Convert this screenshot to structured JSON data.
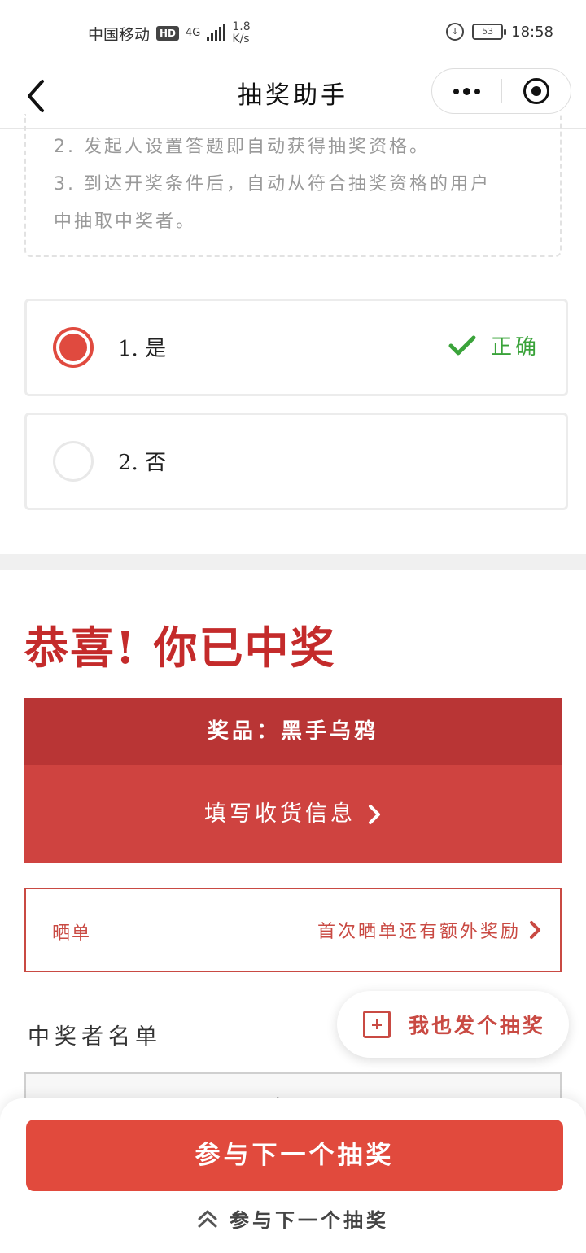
{
  "status_bar": {
    "carrier": "中国移动",
    "hd": "HD",
    "network": "4G",
    "speed_value": "1.8",
    "speed_unit": "K/s",
    "battery": "53",
    "time": "18:58"
  },
  "nav": {
    "title": "抽奖助手"
  },
  "rules": [
    "2. 发起人设置答题即自动获得抽奖资格。",
    "3. 到达开奖条件后，自动从符合抽奖资格的用户",
    "中抽取中奖者。"
  ],
  "options": [
    {
      "label": "1. 是",
      "selected": true,
      "result": "正确"
    },
    {
      "label": "2. 否",
      "selected": false,
      "result": ""
    }
  ],
  "congrats": "恭喜! 你已中奖",
  "prize": {
    "name": "奖品：黑手乌鸦",
    "fill_info": "填写收货信息"
  },
  "share": {
    "label": "晒单",
    "hint": "首次晒单还有额外奖励"
  },
  "winners": {
    "title": "中奖者名单",
    "partial_text": "点..."
  },
  "fab": {
    "label": "我也发个抽奖"
  },
  "bottom": {
    "next_button": "参与下一个抽奖",
    "sub_link": "参与下一个抽奖"
  },
  "colors": {
    "accent_red": "#e14a3d",
    "dark_red": "#b93535",
    "correct_green": "#3aa33a"
  }
}
